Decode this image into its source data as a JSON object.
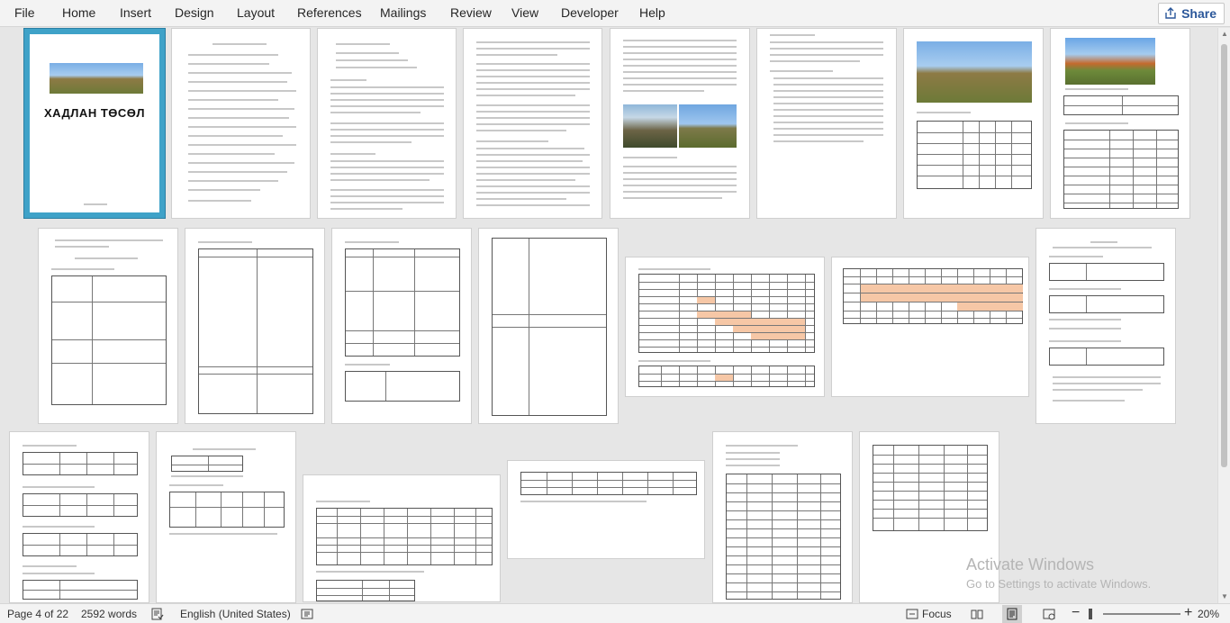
{
  "ribbon": {
    "tabs": [
      "File",
      "Home",
      "Insert",
      "Design",
      "Layout",
      "References",
      "Mailings",
      "Review",
      "View",
      "Developer",
      "Help"
    ],
    "share_label": "Share"
  },
  "document": {
    "cover_title": "ХАДЛАН ТӨСӨЛ"
  },
  "watermark": {
    "line1": "Activate Windows",
    "line2": "Go to Settings to activate Windows."
  },
  "status": {
    "page": "Page 4 of 22",
    "words": "2592 words",
    "language": "English (United States)",
    "focus": "Focus",
    "zoom": "20%"
  }
}
